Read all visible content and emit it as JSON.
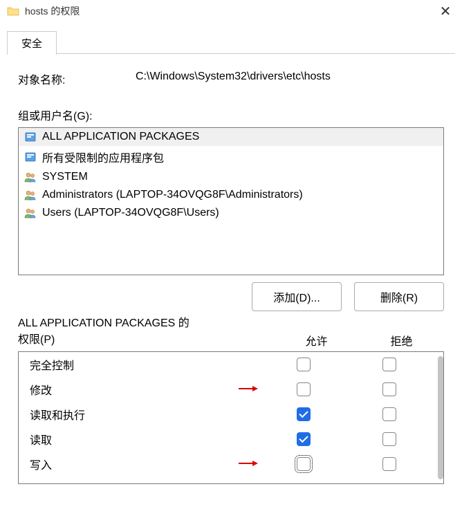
{
  "titlebar": {
    "title": "hosts 的权限"
  },
  "tab": {
    "security": "安全"
  },
  "object_row": {
    "label": "对象名称:",
    "value": "C:\\Windows\\System32\\drivers\\etc\\hosts"
  },
  "groups": {
    "label": "组或用户名(G):",
    "items": [
      {
        "name": "ALL APPLICATION PACKAGES",
        "iconType": "package",
        "selected": true
      },
      {
        "name": "所有受限制的应用程序包",
        "iconType": "package",
        "selected": false
      },
      {
        "name": "SYSTEM",
        "iconType": "users",
        "selected": false
      },
      {
        "name": "Administrators (LAPTOP-34OVQG8F\\Administrators)",
        "iconType": "users",
        "selected": false
      },
      {
        "name": "Users (LAPTOP-34OVQG8F\\Users)",
        "iconType": "users",
        "selected": false
      }
    ]
  },
  "buttons": {
    "add": "添加(D)...",
    "remove": "删除(R)"
  },
  "permissions": {
    "header_line1": "ALL APPLICATION PACKAGES 的",
    "header_line2": "权限(P)",
    "col_allow": "允许",
    "col_deny": "拒绝",
    "rows": [
      {
        "name": "完全控制",
        "allow": false,
        "deny": false,
        "arrow": false,
        "focused": false
      },
      {
        "name": "修改",
        "allow": false,
        "deny": false,
        "arrow": true,
        "focused": false
      },
      {
        "name": "读取和执行",
        "allow": true,
        "deny": false,
        "arrow": false,
        "focused": false
      },
      {
        "name": "读取",
        "allow": true,
        "deny": false,
        "arrow": false,
        "focused": false
      },
      {
        "name": "写入",
        "allow": false,
        "deny": false,
        "arrow": true,
        "focused": true
      }
    ]
  }
}
